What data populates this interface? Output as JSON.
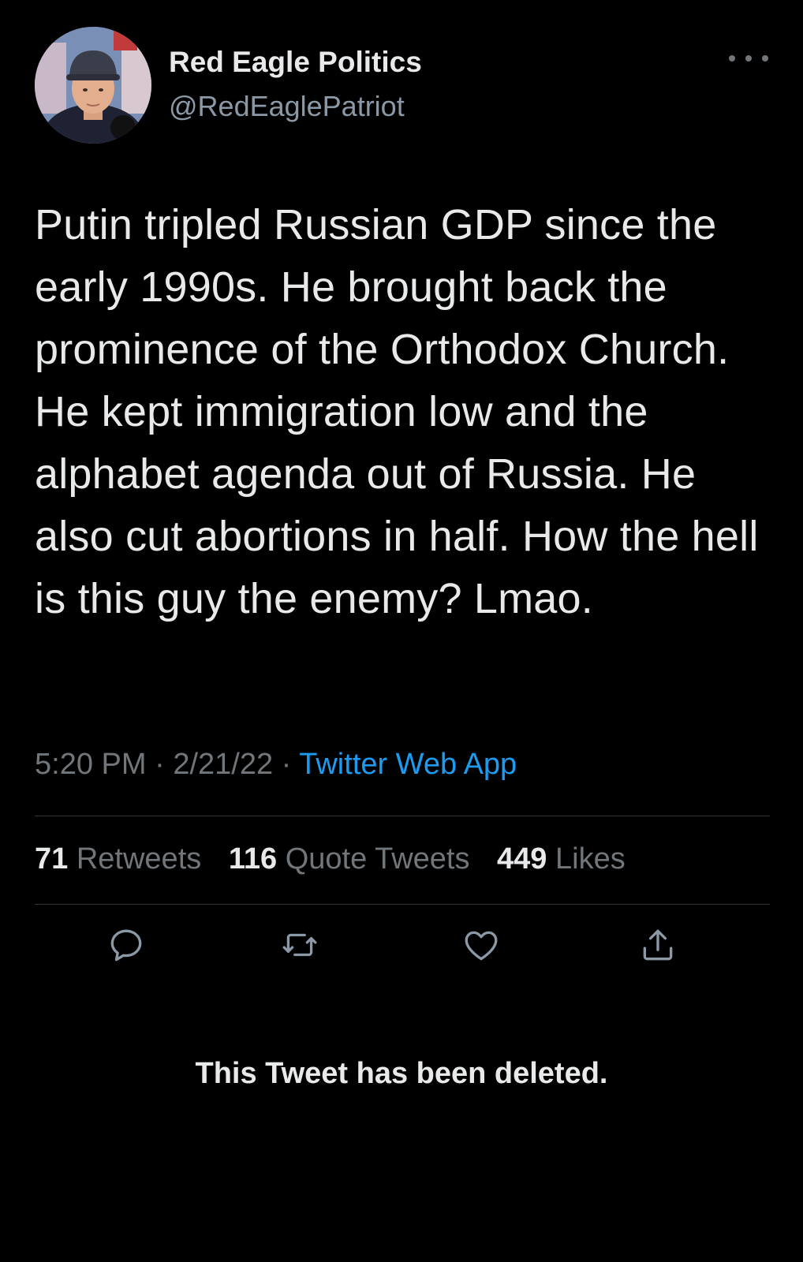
{
  "author": {
    "name": "Red Eagle Politics",
    "handle": "@RedEaglePatriot",
    "avatar_icon": "profile-photo"
  },
  "tweet": {
    "text": "Putin tripled Russian GDP since the early 1990s. He brought back the prominence of the Orthodox Church. He kept immigration low and the alphabet agenda out of Russia. He also cut abortions in half. How the hell is this guy the enemy? Lmao.",
    "time": "5:20 PM",
    "date": "2/21/22",
    "separator": "·",
    "source": "Twitter Web App"
  },
  "stats": {
    "retweets_count": "71",
    "retweets_label": "Retweets",
    "quotes_count": "116",
    "quotes_label": "Quote Tweets",
    "likes_count": "449",
    "likes_label": "Likes"
  },
  "actions": [
    {
      "icon": "reply-icon"
    },
    {
      "icon": "retweet-icon"
    },
    {
      "icon": "like-icon"
    },
    {
      "icon": "share-icon"
    }
  ],
  "notice": "This Tweet has been deleted.",
  "colors": {
    "background": "#000000",
    "text": "#e7e9ea",
    "secondary": "#71767b",
    "link": "#1d9bf0",
    "divider": "#2f3336"
  }
}
